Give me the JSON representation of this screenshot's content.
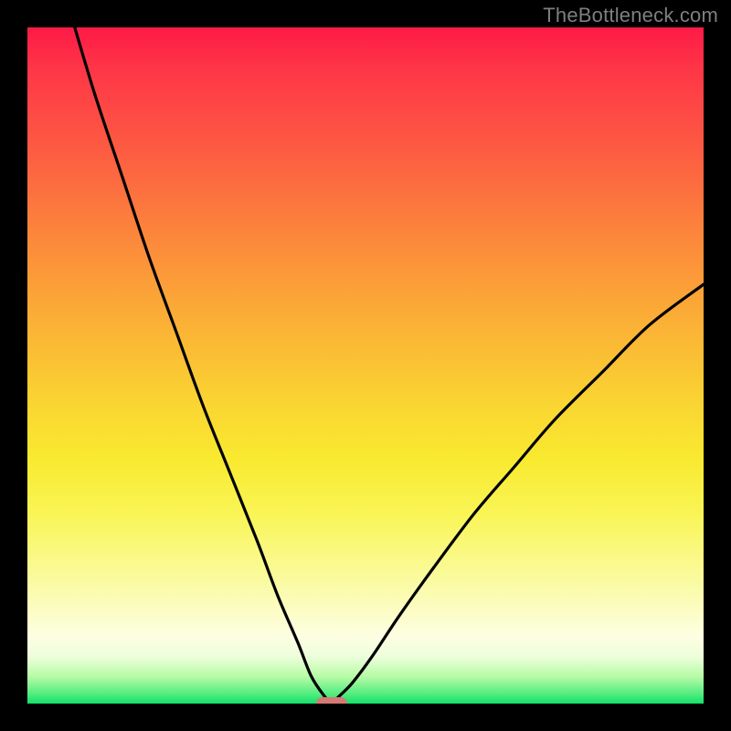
{
  "watermark": "TheBottleneck.com",
  "colors": {
    "frame": "#000000",
    "curve": "#000000",
    "marker": "#d47a74",
    "watermark": "#7f7f7f",
    "gradient_stops": [
      "#fe1a47",
      "#fe3547",
      "#fd5b42",
      "#fc843c",
      "#fbab36",
      "#fad332",
      "#f9ea30",
      "#f9f556",
      "#faf98b",
      "#fbfcba",
      "#fdfee2",
      "#eefedb",
      "#b7fba6",
      "#56ed80",
      "#14e069"
    ]
  },
  "chart_data": {
    "type": "line",
    "title": "",
    "xlabel": "",
    "ylabel": "",
    "xlim": [
      0,
      100
    ],
    "ylim": [
      0,
      100
    ],
    "grid": false,
    "legend": false,
    "background": "vertical-gradient red→yellow→green",
    "series": [
      {
        "name": "bottleneck-curve",
        "comment": "V-shaped curve; y≈0 at x≈45; left branch reaches y≈100 near x≈7, right branch reaches y≈62 at x=100. Values estimated from pixels.",
        "x": [
          7,
          10,
          14,
          18,
          22,
          26,
          30,
          34,
          37,
          40,
          42,
          44,
          45,
          46,
          48,
          51,
          55,
          60,
          66,
          72,
          78,
          85,
          92,
          100
        ],
        "y": [
          100,
          90,
          78,
          66,
          55,
          44,
          34,
          24,
          16,
          9,
          4,
          1,
          0,
          1,
          3,
          7,
          13,
          20,
          28,
          35,
          42,
          49,
          56,
          62
        ]
      }
    ],
    "marker": {
      "name": "optimum-point",
      "shape": "rounded-pill",
      "x": 45,
      "y": 0,
      "color": "#d47a74"
    }
  }
}
